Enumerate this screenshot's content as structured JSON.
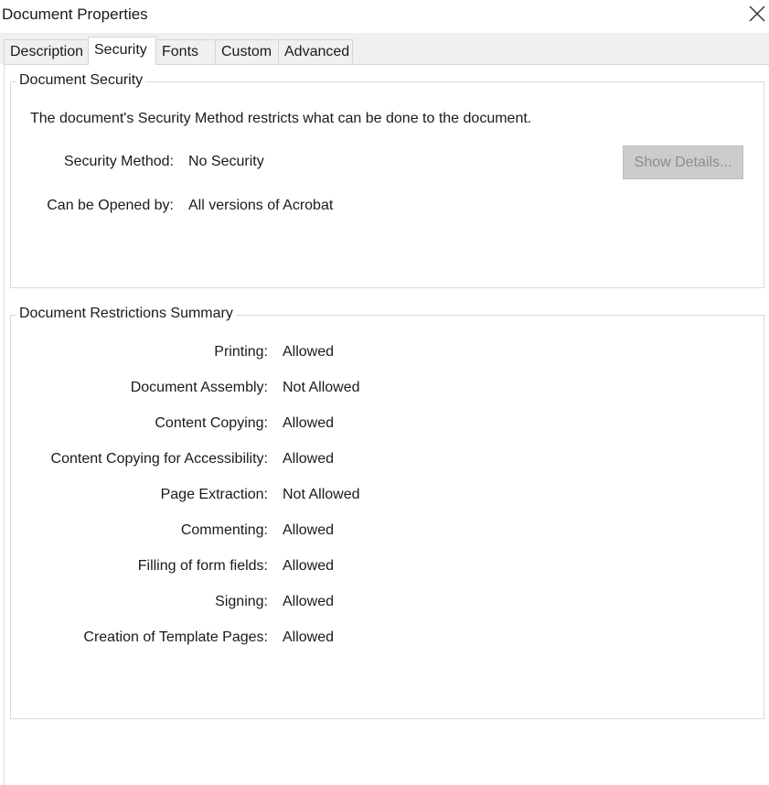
{
  "window": {
    "title": "Document Properties",
    "close_icon": "close-icon"
  },
  "tabs": [
    {
      "label": "Description",
      "active": false
    },
    {
      "label": "Security",
      "active": true
    },
    {
      "label": "Fonts",
      "active": false
    },
    {
      "label": "Custom",
      "active": false
    },
    {
      "label": "Advanced",
      "active": false
    }
  ],
  "security": {
    "group_title": "Document Security",
    "description": "The document's Security Method restricts what can be done to the document.",
    "method_label": "Security Method:",
    "method_value": "No Security",
    "opened_label": "Can be Opened by:",
    "opened_value": "All versions of Acrobat",
    "show_details_label": "Show Details..."
  },
  "restrictions": {
    "group_title": "Document Restrictions Summary",
    "items": [
      {
        "label": "Printing:",
        "value": "Allowed"
      },
      {
        "label": "Document Assembly:",
        "value": "Not Allowed"
      },
      {
        "label": "Content Copying:",
        "value": "Allowed"
      },
      {
        "label": "Content Copying for Accessibility:",
        "value": "Allowed"
      },
      {
        "label": "Page Extraction:",
        "value": "Not Allowed"
      },
      {
        "label": "Commenting:",
        "value": "Allowed"
      },
      {
        "label": "Filling of form fields:",
        "value": "Allowed"
      },
      {
        "label": "Signing:",
        "value": "Allowed"
      },
      {
        "label": "Creation of Template Pages:",
        "value": "Allowed"
      }
    ]
  }
}
